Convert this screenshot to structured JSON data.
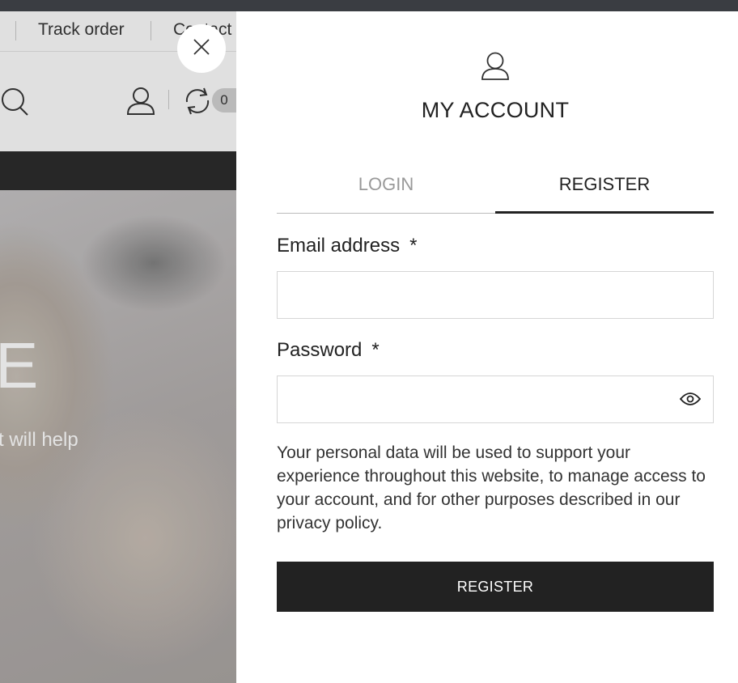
{
  "background_page": {
    "nav_links": [
      "Track order",
      "Contact"
    ],
    "cart_count": "0",
    "hero_headline_fragment": "E",
    "hero_subtitle_fragment": "t will help"
  },
  "close_icon": "close-icon",
  "account": {
    "icon": "user-icon",
    "title": "MY ACCOUNT",
    "tabs": [
      {
        "label": "LOGIN",
        "active": false
      },
      {
        "label": "REGISTER",
        "active": true
      }
    ],
    "email": {
      "label": "Email address",
      "required_mark": "*",
      "value": "",
      "placeholder": ""
    },
    "password": {
      "label": "Password",
      "required_mark": "*",
      "value": "",
      "placeholder": "",
      "toggle_icon": "eye-icon"
    },
    "privacy_notice": "Your personal data will be used to support your experience throughout this website, to manage access to your account, and for other purposes described in our privacy policy.",
    "submit_label": "REGISTER"
  },
  "colors": {
    "primary_dark": "#222222",
    "tab_inactive": "#999999"
  }
}
